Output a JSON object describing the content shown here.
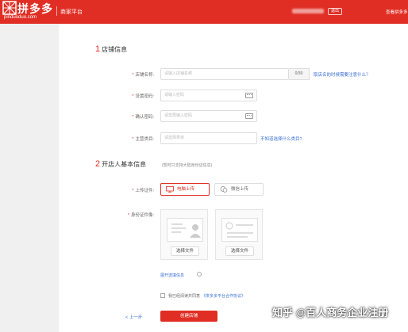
{
  "header": {
    "logo_text": "拼多多",
    "logo_sub": "pinduoduo.com",
    "app_name": "商家平台",
    "logout_label": "退出",
    "login_link": "查看拼多多"
  },
  "section1": {
    "number": "1",
    "title": "店铺信息",
    "fields": {
      "shop_name": {
        "label": "店铺名称:",
        "placeholder": "请输入店铺名称",
        "count": "0/30",
        "help": "取店名的时候需要注意什么？"
      },
      "password": {
        "label": "设置密码:",
        "placeholder": "请输入密码"
      },
      "confirm_password": {
        "label": "确认密码:",
        "placeholder": "请您再输入密码"
      },
      "category": {
        "label": "主营类目:",
        "placeholder": "请选择类目",
        "help": "不知道选择什么类目?"
      }
    }
  },
  "section2": {
    "number": "2",
    "title": "开店人基本信息",
    "note": "(暂时只支持大陆身份证信息)",
    "upload_label": "上传证件:",
    "upload_pc": "电脑上传",
    "upload_wechat": "微信上传",
    "id_label": "身份证件像:",
    "choose_file_1": "选择文件",
    "choose_file_2": "选择文件",
    "expand": "展开选填信息"
  },
  "agreement": {
    "text": "我已经阅读并同意",
    "link": "《拼多多平台合作协议》"
  },
  "actions": {
    "prev": "< 上一步",
    "create": "创建店铺"
  },
  "watermark": "知乎 @百人商务企业注册",
  "colors": {
    "brand": "#e02e24",
    "link": "#3a6fd6"
  }
}
